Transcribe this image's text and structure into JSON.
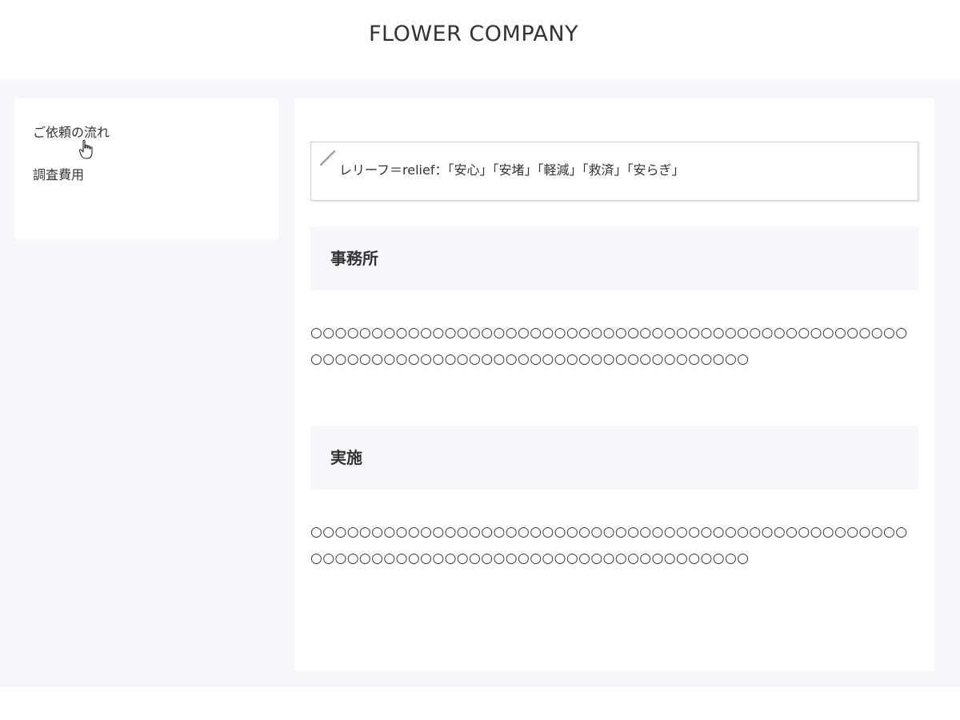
{
  "header": {
    "site_title": "FLOWER COMPANY"
  },
  "sidebar": {
    "items": [
      {
        "label": "ご依頼の流れ"
      },
      {
        "label": "調査費用"
      }
    ]
  },
  "main": {
    "note": {
      "icon": "pencil-icon",
      "text": "レリーフ＝relief：「安心」「安堵」「軽減」「救済」「安らぎ」"
    },
    "sections": [
      {
        "heading": "事務所",
        "body": "○○○○○○○○○○○○○○○○○○○○○○○○○○○○○○○○○○○○○○○○○○○○○○○○○○○○○○○○○○○○○○○○○○○○○○○○○○○○○○○○○○○○○"
      },
      {
        "heading": "実施",
        "body": "○○○○○○○○○○○○○○○○○○○○○○○○○○○○○○○○○○○○○○○○○○○○○○○○○○○○○○○○○○○○○○○○○○○○○○○○○○○○○○○○○○○○○"
      }
    ]
  },
  "colors": {
    "page_background": "#f7f6fa",
    "card_background": "#ffffff",
    "heading_background": "#f7f6fa",
    "text": "#333333",
    "note_border": "#d0d0d0"
  }
}
